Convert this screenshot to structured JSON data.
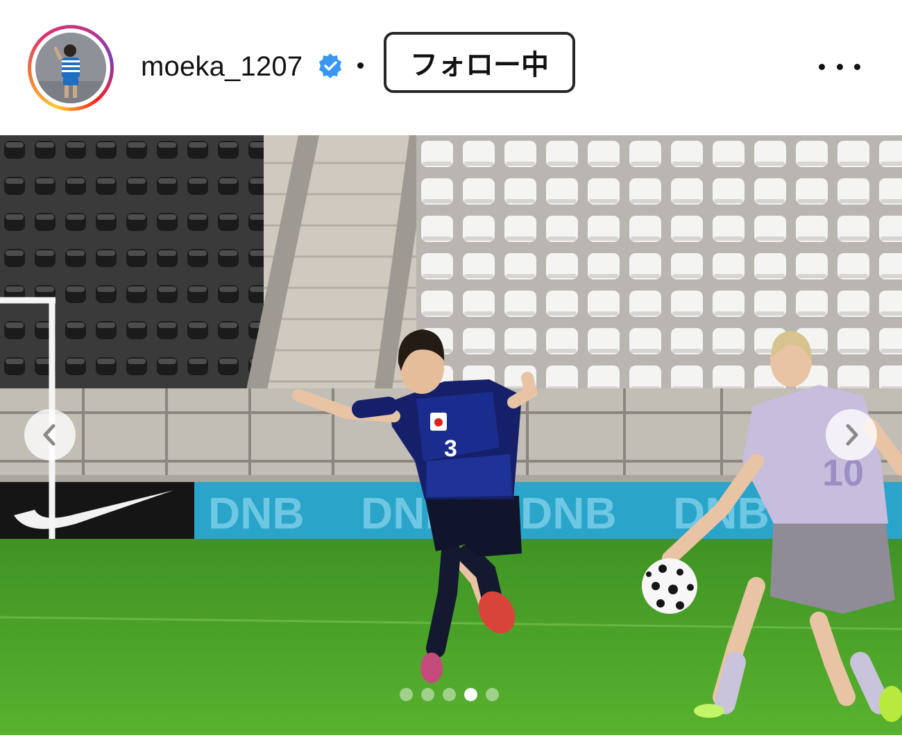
{
  "post_header": {
    "username": "moeka_1207",
    "verified_icon": "verified-badge-icon",
    "separator": "•",
    "follow_button_label": "フォロー中",
    "more_icon": "more-options-icon"
  },
  "carousel": {
    "prev_icon": "chevron-left-icon",
    "next_icon": "chevron-right-icon",
    "slide_count": 5,
    "active_slide": 4
  },
  "photo": {
    "board_text": [
      "DNB",
      "DNB",
      "DNB",
      "DNB"
    ],
    "player_number": "3"
  },
  "colors": {
    "verified_blue": "#3897f0",
    "pitch_green": "#4fa62a",
    "board_blue": "#2aa4c9"
  }
}
